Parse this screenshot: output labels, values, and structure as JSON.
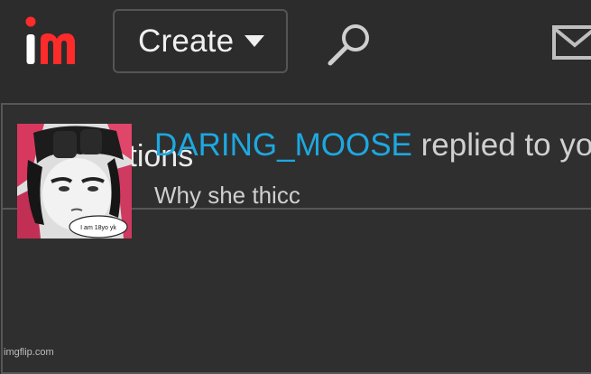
{
  "header": {
    "logo_text": "im",
    "create_label": "Create",
    "search_icon": "search-icon",
    "mail_icon": "mail-icon"
  },
  "panel": {
    "title": "Notifications"
  },
  "notification": {
    "username": "DARING_MOOSE",
    "action": "replied to yo",
    "preview": "Why she thicc",
    "avatar_caption": "I am 18yo yk"
  },
  "watermark": "imgflip.com",
  "colors": {
    "background": "#2c2c2c",
    "border": "#575757",
    "username": "#1da8e0",
    "logo_i": "#ffffff",
    "logo_m": "#ff2b2b"
  }
}
